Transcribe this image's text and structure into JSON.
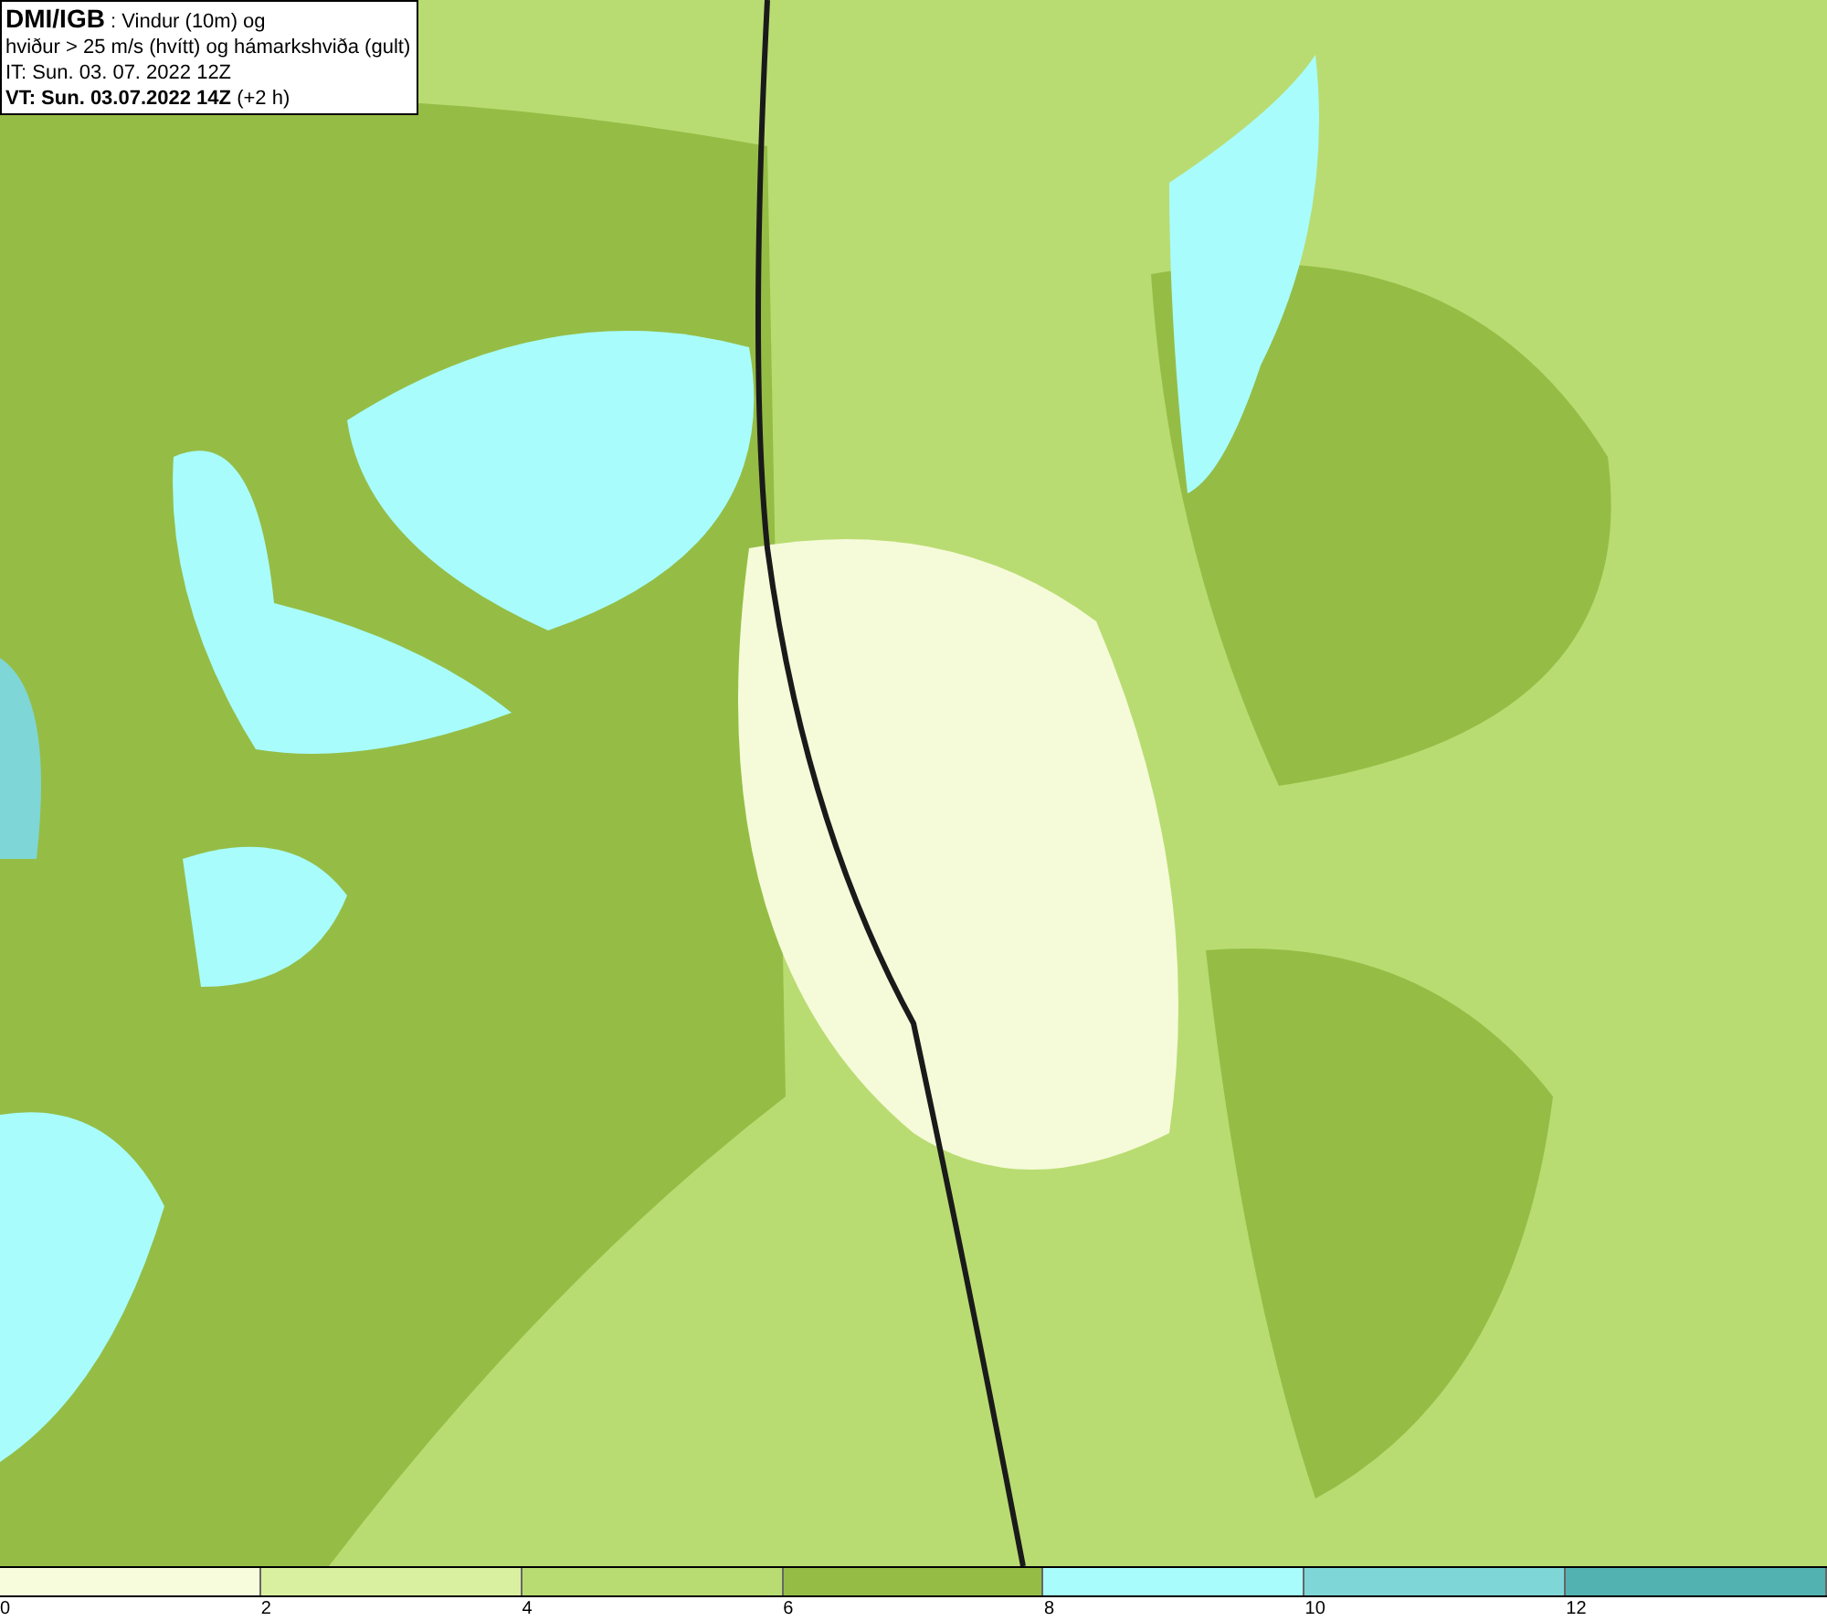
{
  "info_box": {
    "lines": [
      "**DMI/IGB** : Vindur (10m) og",
      "hviður > 25 m/s (hvítt) og hámarkshviða (gult)",
      "IT: Sun. 03. 07. 2022 12Z",
      "**VT: Sun. 03.07.2022 14Z** (+2 h)"
    ]
  },
  "legend": {
    "bins": [
      {
        "color": "#f7fcdc"
      },
      {
        "color": "#d9f0a0"
      },
      {
        "color": "#b9dc72"
      },
      {
        "color": "#95bd45"
      },
      {
        "color": "#a8fcfc"
      },
      {
        "color": "#7fd6d6"
      },
      {
        "color": "#52b2b2"
      }
    ],
    "ticks": [
      "0",
      "2",
      "4",
      "6",
      "8",
      "10",
      "12"
    ]
  }
}
